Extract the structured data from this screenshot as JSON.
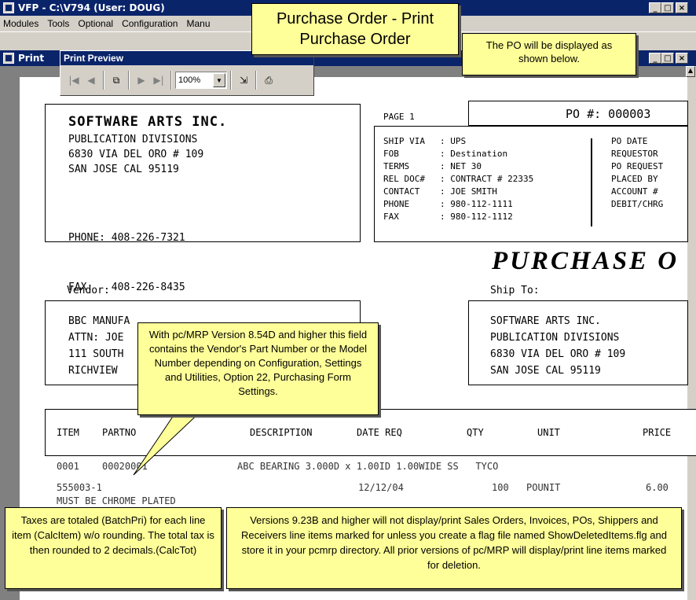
{
  "app": {
    "title": "VFP - C:\\V794  (User: DOUG)",
    "menu": [
      "Modules",
      "Tools",
      "Optional",
      "Configuration",
      "Manu"
    ]
  },
  "inner_window": {
    "title": "Print"
  },
  "preview": {
    "title": "Print Preview",
    "zoom": "100%"
  },
  "callouts": {
    "heading_line1": "Purchase Order - Print",
    "heading_line2": "Purchase Order",
    "display_note": "The PO will be displayed as shown below.",
    "vendor_part": "With pc/MRP Version 8.54D and higher this field contains the Vendor's Part Number or the Model Number depending on Configuration, Settings and Utilities, Option 22, Purchasing Form Settings.",
    "taxes": "Taxes are totaled (BatchPri) for each line item (CalcItem) w/o rounding.  The total tax is then rounded to 2 decimals.(CalcTot)",
    "versions": "Versions 9.23B and higher will not display/print Sales Orders, Invoices, POs, Shippers and Receivers line items marked for unless you create a flag file named ShowDeletedItems.flg and store it in your pcmrp directory.  All prior versions of pc/MRP will display/print line items marked for deletion."
  },
  "doc": {
    "company": "SOFTWARE ARTS INC.",
    "company_lines": [
      "PUBLICATION DIVISIONS",
      "6830 VIA DEL ORO # 109",
      "SAN JOSE CAL 95119"
    ],
    "phone": "PHONE: 408-226-7321",
    "fax": "FAX:   408-226-8435",
    "page": "PAGE 1",
    "po_number": "PO #: 000003",
    "ship_fields": [
      {
        "label": "SHIP VIA",
        "value": ": UPS"
      },
      {
        "label": "FOB",
        "value": ": Destination"
      },
      {
        "label": "TERMS",
        "value": ": NET 30"
      },
      {
        "label": "REL DOC#",
        "value": ": CONTRACT # 22335"
      },
      {
        "label": "CONTACT",
        "value": ": JOE SMITH"
      },
      {
        "label": "PHONE",
        "value": ": 980-112-1111"
      },
      {
        "label": "FAX",
        "value": ": 980-112-1112"
      }
    ],
    "right_fields": [
      "PO DATE",
      "REQUESTOR",
      "PO REQUEST",
      "PLACED BY",
      "ACCOUNT #",
      "DEBIT/CHRG"
    ],
    "doc_title": "PURCHASE O",
    "vendor_label": "Vendor:",
    "vendor_lines": [
      "BBC MANUFA",
      "ATTN: JOE",
      "111 SOUTH",
      "RICHVIEW"
    ],
    "shipto_label": "Ship To:",
    "shipto_lines": [
      "SOFTWARE ARTS INC.",
      "PUBLICATION DIVISIONS",
      "6830 VIA DEL ORO # 109",
      "SAN JOSE CAL 95119"
    ],
    "columns": {
      "item": "ITEM",
      "partno": "PARTNO",
      "desc": "DESCRIPTION",
      "date_req": "DATE REQ",
      "qty": "QTY",
      "unit": "UNIT",
      "price": "PRICE"
    },
    "line": {
      "item": "0001",
      "partno": "00020001",
      "desc": "ABC BEARING 3.000D x 1.00ID 1.00WIDE SS   TYCO",
      "part2": "555003-1",
      "date": "12/12/04",
      "qty": "100",
      "unit": "POUNIT",
      "price": "6.00",
      "note": "MUST BE CHROME PLATED"
    }
  }
}
